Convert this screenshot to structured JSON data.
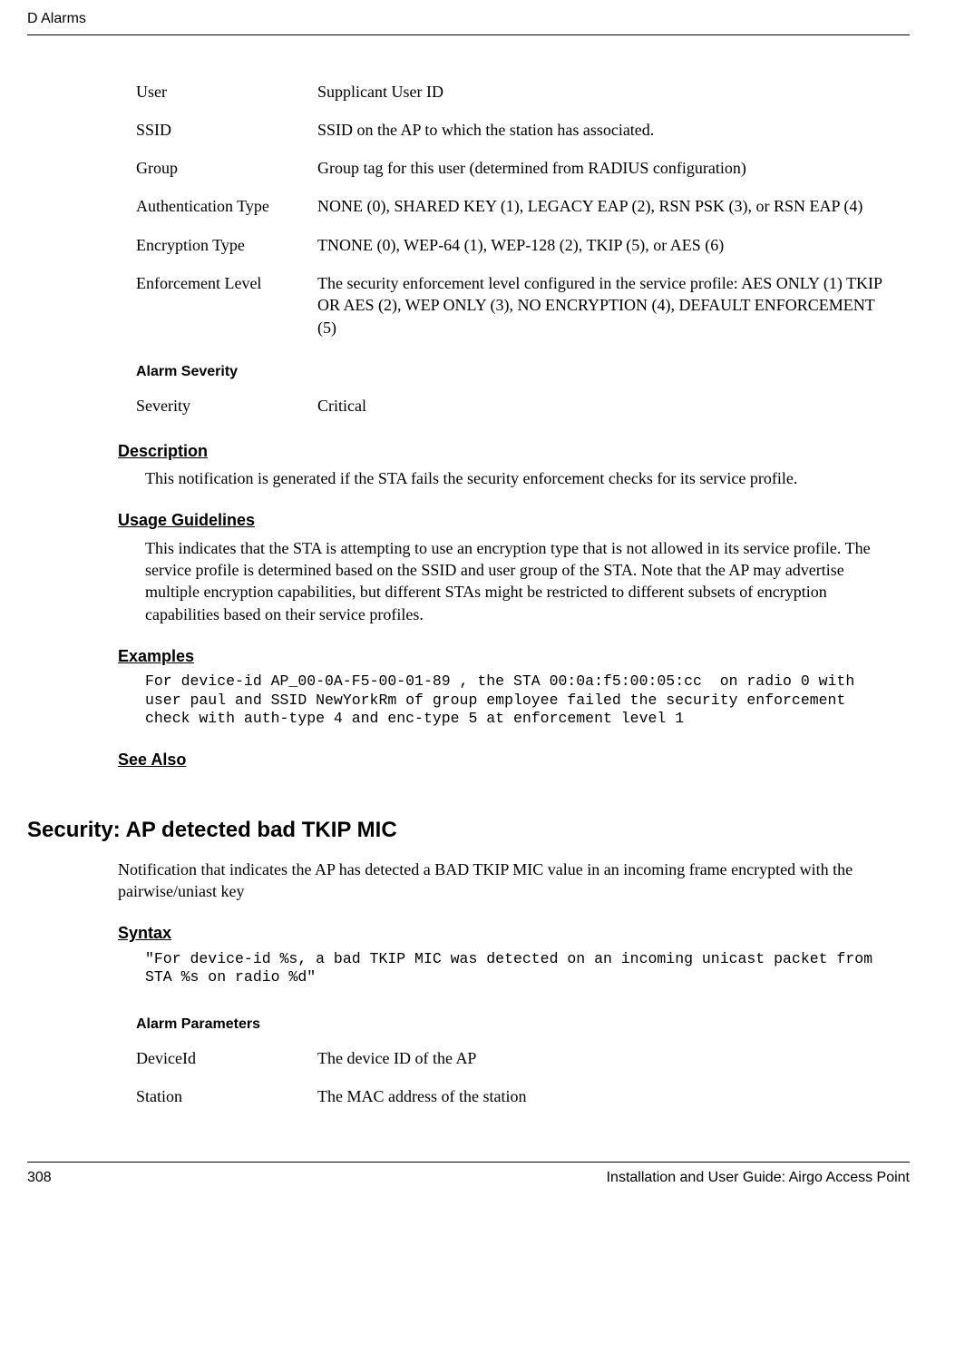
{
  "header": {
    "left": "D  Alarms",
    "right": ""
  },
  "params1": [
    {
      "key": "User",
      "val": "Supplicant User ID"
    },
    {
      "key": "SSID",
      "val": "SSID on the AP to which the station has associated."
    },
    {
      "key": "Group",
      "val": "Group tag for this user (determined from RADIUS configuration)"
    },
    {
      "key": "Authentication Type",
      "val": "NONE (0), SHARED KEY (1), LEGACY EAP (2), RSN PSK (3), or RSN EAP (4)"
    },
    {
      "key": "Encryption Type",
      "val": "TNONE (0), WEP-64 (1), WEP-128 (2), TKIP (5), or AES (6)"
    },
    {
      "key": "Enforcement Level",
      "val": "The security enforcement level configured in the service profile: AES ONLY (1) TKIP OR AES (2), WEP ONLY (3), NO ENCRYPTION (4), DEFAULT ENFORCEMENT (5)"
    }
  ],
  "severity_heading": "Alarm Severity",
  "severity": [
    {
      "key": "Severity",
      "val": "Critical"
    }
  ],
  "sections": {
    "description": {
      "title": "Description",
      "text": "This notification is generated if the STA fails the security enforcement checks for its service profile."
    },
    "usage": {
      "title": "Usage Guidelines",
      "text": "This indicates that the STA is attempting to use an encryption type that is not allowed in its service profile. The service profile is determined based on the SSID and user group of the STA. Note that the AP may advertise multiple encryption capabilities, but different STAs might be restricted to different subsets of encryption capabilities based on their service profiles."
    },
    "examples": {
      "title": "Examples",
      "code": "For device-id AP_00-0A-F5-00-01-89 , the STA 00:0a:f5:00:05:cc  on radio 0 with user paul and SSID NewYorkRm of group employee failed the security enforcement check with auth-type 4 and enc-type 5 at enforcement level 1"
    },
    "seealso": {
      "title": "See Also"
    }
  },
  "section2": {
    "title": "Security: AP detected bad TKIP MIC",
    "intro": "Notification that indicates the AP has detected a BAD TKIP MIC value in an incoming frame encrypted with the pairwise/uniast key",
    "syntax": {
      "title": "Syntax",
      "code": "\"For device-id %s, a bad TKIP MIC was detected on an incoming unicast packet from STA %s on radio %d\""
    },
    "params_heading": "Alarm Parameters",
    "params": [
      {
        "key": "DeviceId",
        "val": "The device ID of the AP"
      },
      {
        "key": "Station",
        "val": "The MAC address of the station"
      }
    ]
  },
  "footer": {
    "left": "308",
    "right": "Installation and User Guide: Airgo Access Point"
  }
}
